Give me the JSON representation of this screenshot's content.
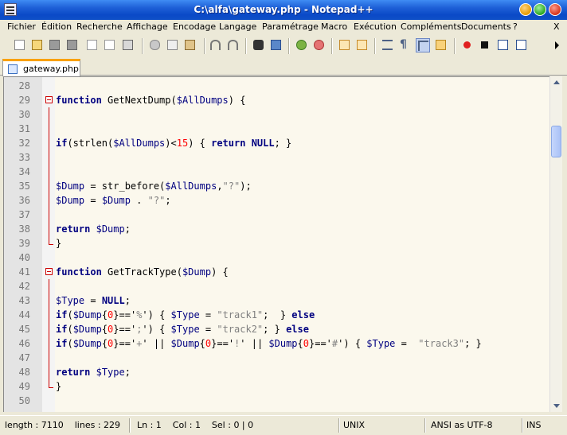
{
  "window": {
    "title": "C:\\alfa\\gateway.php - Notepad++"
  },
  "menu": {
    "items": [
      "Fichier",
      "Édition",
      "Recherche",
      "Affichage",
      "Encodage",
      "Langage",
      "Paramétrage",
      "Macro",
      "Exécution",
      "Compléments",
      "Documents",
      "?"
    ],
    "close_doc": "X"
  },
  "tab": {
    "label": "gateway.php"
  },
  "editor": {
    "lines": [
      {
        "n": "28"
      },
      {
        "n": "29"
      },
      {
        "n": "30"
      },
      {
        "n": "31"
      },
      {
        "n": "32"
      },
      {
        "n": "33"
      },
      {
        "n": "34"
      },
      {
        "n": "35"
      },
      {
        "n": "36"
      },
      {
        "n": "37"
      },
      {
        "n": "38"
      },
      {
        "n": "39"
      },
      {
        "n": "40"
      },
      {
        "n": "41"
      },
      {
        "n": "42"
      },
      {
        "n": "43"
      },
      {
        "n": "44"
      },
      {
        "n": "45"
      },
      {
        "n": "46"
      },
      {
        "n": "47"
      },
      {
        "n": "48"
      },
      {
        "n": "49"
      },
      {
        "n": "50"
      }
    ],
    "code": {
      "l29": [
        "function",
        " GetNextDump(",
        "$AllDumps",
        ") {"
      ],
      "l32": [
        "if",
        "(strlen(",
        "$AllDumps",
        ")<",
        "15",
        ") { ",
        "return",
        " ",
        "NULL",
        "; }"
      ],
      "l35": [
        "$Dump",
        " = str_before(",
        "$AllDumps",
        ",",
        "\"?\"",
        ");"
      ],
      "l36": [
        "$Dump",
        " = ",
        "$Dump",
        " . ",
        "\"?\"",
        ";"
      ],
      "l38": [
        "return",
        " ",
        "$Dump",
        ";"
      ],
      "l39": [
        "}"
      ],
      "l41": [
        "function",
        " GetTrackType(",
        "$Dump",
        ") {"
      ],
      "l43": [
        "$Type",
        " = ",
        "NULL",
        ";"
      ],
      "l44": [
        "if",
        "(",
        "$Dump",
        "{",
        "0",
        "}=='",
        "%",
        "') { ",
        "$Type",
        " = ",
        "\"track1\"",
        ";  } ",
        "else"
      ],
      "l45": [
        "if",
        "(",
        "$Dump",
        "{",
        "0",
        "}=='",
        ";",
        "') { ",
        "$Type",
        " = ",
        "\"track2\"",
        "; } ",
        "else"
      ],
      "l46": [
        "if",
        "(",
        "$Dump",
        "{",
        "0",
        "}=='",
        "+",
        "' || ",
        "$Dump",
        "{",
        "0",
        "}=='",
        "!",
        "' || ",
        "$Dump",
        "{",
        "0",
        "}=='",
        "#",
        "') { ",
        "$Type",
        " =  ",
        "\"track3\"",
        "; }"
      ],
      "l48": [
        "return",
        " ",
        "$Type",
        ";"
      ],
      "l49": [
        "}"
      ]
    }
  },
  "status": {
    "length": "length : 7110    lines : 229",
    "pos": "Ln : 1    Col : 1    Sel : 0 | 0",
    "eol": "UNIX",
    "encoding": "ANSI as UTF-8",
    "mode": "INS"
  },
  "colors": {
    "keyword": "#000080",
    "number": "#ff0000",
    "string": "#808080",
    "fold_marker": "#cc0000",
    "tab_accent": "#f9a100",
    "editor_bg": "#fbf8ed"
  },
  "toolbar_icons": [
    "new-file-icon",
    "open-file-icon",
    "save-icon",
    "save-all-icon",
    "close-icon",
    "close-all-icon",
    "print-icon",
    "cut-icon",
    "copy-icon",
    "paste-icon",
    "undo-icon",
    "redo-icon",
    "find-icon",
    "replace-icon",
    "zoom-in-icon",
    "zoom-out-icon",
    "sync-v-icon",
    "sync-h-icon",
    "wrap-icon",
    "show-all-chars-icon",
    "indent-guide-icon",
    "user-lang-icon",
    "record-macro-icon",
    "stop-macro-icon",
    "play-macro-icon",
    "run-macro-multiple-icon"
  ]
}
